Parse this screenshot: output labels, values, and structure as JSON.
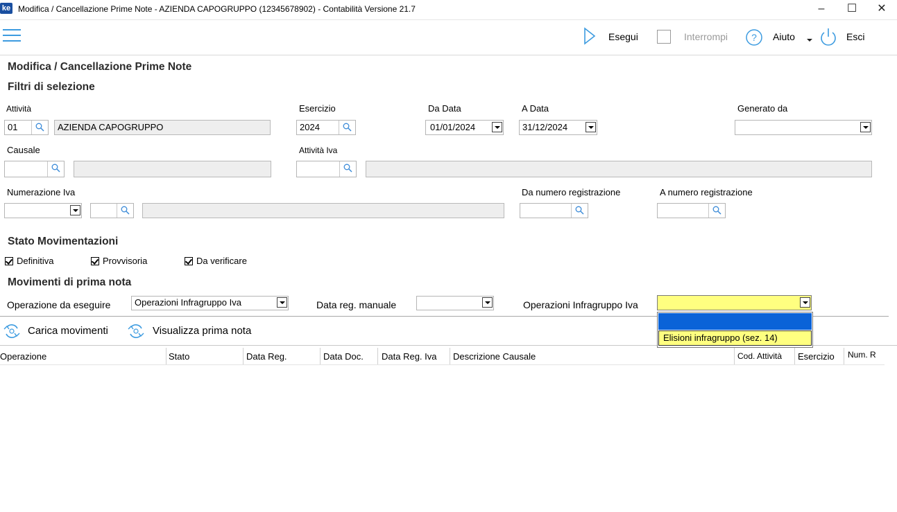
{
  "window": {
    "logo": "ke",
    "title": "Modifica / Cancellazione Prime Note - AZIENDA CAPOGRUPPO (12345678902) - Contabilità Versione 21.7",
    "minimize": "–",
    "maximize": "☐",
    "close": "✕"
  },
  "toolbar": {
    "run_label": "Esegui",
    "stop_label": "Interrompi",
    "help_label": "Aiuto",
    "exit_label": "Esci"
  },
  "page": {
    "title": "Modifica / Cancellazione Prime Note",
    "filters_title": "Filtri di selezione"
  },
  "filters": {
    "attivita_label": "Attività",
    "attivita_code": "01",
    "attivita_desc": "AZIENDA CAPOGRUPPO",
    "esercizio_label": "Esercizio",
    "esercizio_value": "2024",
    "da_data_label": "Da Data",
    "da_data_value": "01/01/2024",
    "a_data_label": "A Data",
    "a_data_value": "31/12/2024",
    "generato_da_label": "Generato da",
    "generato_da_value": "",
    "causale_label": "Causale",
    "causale_code": "",
    "causale_desc": "",
    "attivita_iva_label": "Attività Iva",
    "attivita_iva_code": "",
    "attivita_iva_desc": "",
    "numerazione_iva_label": "Numerazione Iva",
    "numerazione_iva_value": "",
    "numerazione_iva_code": "",
    "numerazione_iva_desc": "",
    "da_numero_label": "Da numero registrazione",
    "da_numero_value": "",
    "a_numero_label": "A numero registrazione",
    "a_numero_value": ""
  },
  "stato": {
    "title": "Stato Movimentazioni",
    "definitiva": "Definitiva",
    "provvisoria": "Provvisoria",
    "da_verificare": "Da verificare",
    "definitiva_checked": true,
    "provvisoria_checked": true,
    "da_verificare_checked": true
  },
  "movimenti": {
    "title": "Movimenti di prima nota",
    "operazione_label": "Operazione da eseguire",
    "operazione_value": "Operazioni Infragruppo Iva",
    "data_reg_label": "Data reg. manuale",
    "data_reg_value": "",
    "op_infragruppo_label": "Operazioni Infragruppo Iva",
    "op_infragruppo_value": "",
    "dropdown_options": [
      "",
      "Elisioni infragruppo (sez. 14)"
    ]
  },
  "actions": {
    "carica_label": "Carica movimenti",
    "visualizza_label": "Visualizza prima nota"
  },
  "table": {
    "columns": [
      "Operazione",
      "Stato",
      "Data Reg.",
      "Data Doc.",
      "Data Reg. Iva",
      "Descrizione Causale",
      "Cod. Attività",
      "Esercizio",
      "Num. R"
    ]
  },
  "colors": {
    "accent": "#3c9be0",
    "highlight_yellow": "#ffff80",
    "selection_blue": "#0a63d8"
  }
}
